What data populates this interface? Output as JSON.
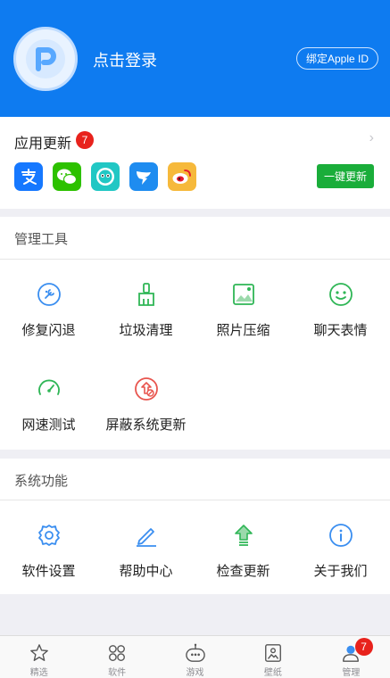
{
  "header": {
    "login_text": "点击登录",
    "apple_button": "绑定Apple ID",
    "accent": "#0e7bf0"
  },
  "updates": {
    "title": "应用更新",
    "badge": "7",
    "button": "一键更新",
    "apps": [
      {
        "name": "alipay-icon",
        "color": "#1678ff"
      },
      {
        "name": "wechat-icon",
        "color": "#2dc100"
      },
      {
        "name": "qq-browser-icon",
        "color": "#21c7c4"
      },
      {
        "name": "dingtalk-icon",
        "color": "#1e8cf0"
      },
      {
        "name": "weibo-icon",
        "color": "#f6b93b"
      }
    ]
  },
  "tools": {
    "title": "管理工具",
    "items": [
      {
        "label": "修复闪退",
        "icon": "repair-icon"
      },
      {
        "label": "垃圾清理",
        "icon": "broom-icon"
      },
      {
        "label": "照片压缩",
        "icon": "photo-icon"
      },
      {
        "label": "聊天表情",
        "icon": "emoji-icon"
      },
      {
        "label": "网速测试",
        "icon": "speedometer-icon"
      },
      {
        "label": "屏蔽系统更新",
        "icon": "block-update-icon"
      }
    ]
  },
  "system": {
    "title": "系统功能",
    "items": [
      {
        "label": "软件设置",
        "icon": "gear-icon"
      },
      {
        "label": "帮助中心",
        "icon": "pencil-icon"
      },
      {
        "label": "检查更新",
        "icon": "upgrade-icon"
      },
      {
        "label": "关于我们",
        "icon": "info-icon"
      }
    ]
  },
  "tabbar": {
    "items": [
      {
        "label": "精选",
        "icon": "star-icon"
      },
      {
        "label": "软件",
        "icon": "apps-icon"
      },
      {
        "label": "游戏",
        "icon": "game-icon"
      },
      {
        "label": "壁纸",
        "icon": "wallpaper-icon"
      },
      {
        "label": "管理",
        "icon": "manage-icon",
        "badge": "7"
      }
    ]
  }
}
